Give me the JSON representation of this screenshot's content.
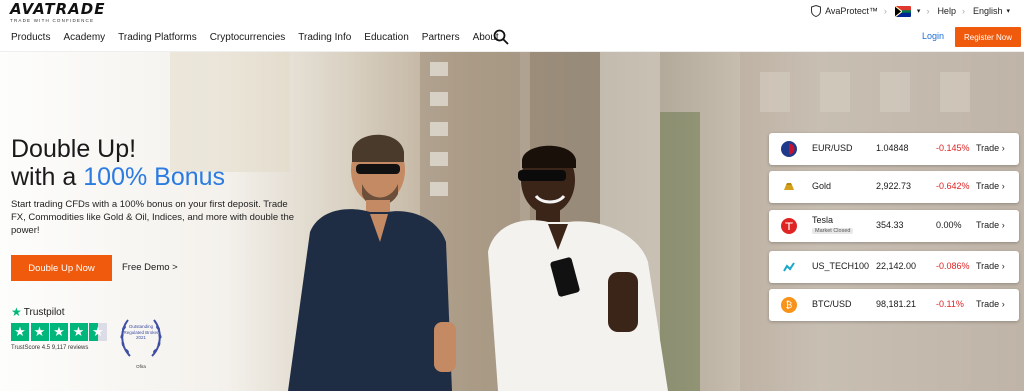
{
  "header": {
    "logo": "AVATRADE",
    "logo_tagline": "TRADE WITH CONFIDENCE",
    "avaprotect": "AvaProtect™",
    "help": "Help",
    "language": "English",
    "region_flag": "south-africa-flag"
  },
  "nav": {
    "items": [
      "Products",
      "Academy",
      "Trading Platforms",
      "Cryptocurrencies",
      "Trading Info",
      "Education",
      "Partners",
      "About"
    ],
    "login": "Login",
    "register": "Register Now"
  },
  "hero": {
    "headline_line1": "Double Up!",
    "headline_line2_prefix": "with a ",
    "headline_line2_accent": "100% Bonus",
    "subtext": "Start trading CFDs with a 100% bonus on your first deposit. Trade FX, Commodities like Gold & Oil, Indices, and more with double the power!",
    "cta": "Double Up Now",
    "demo": "Free Demo >",
    "colors": {
      "accent": "#2b7be0",
      "cta": "#f05a0c"
    }
  },
  "trustpilot": {
    "brand": "Trustpilot",
    "score_text": "TrustScore 4.5 9,117 reviews",
    "stars": 4.5
  },
  "award": {
    "text": "Outstanding Regulated Broker",
    "year": "2021",
    "footer": "Ofira"
  },
  "tickers": [
    {
      "name": "EUR/USD",
      "price": "1.04848",
      "change": "-0.145%",
      "trade": "Trade",
      "icon": "eur-usd-icon",
      "status": ""
    },
    {
      "name": "Gold",
      "price": "2,922.73",
      "change": "-0.642%",
      "trade": "Trade",
      "icon": "gold-icon",
      "status": ""
    },
    {
      "name": "Tesla",
      "price": "354.33",
      "change": "0.00%",
      "trade": "Trade",
      "icon": "tesla-icon",
      "status": "Market Closed"
    },
    {
      "name": "US_TECH100",
      "price": "22,142.00",
      "change": "-0.086%",
      "trade": "Trade",
      "icon": "us-tech100-icon",
      "status": ""
    },
    {
      "name": "BTC/USD",
      "price": "98,181.21",
      "change": "-0.11%",
      "trade": "Trade",
      "icon": "btc-icon",
      "status": ""
    }
  ]
}
